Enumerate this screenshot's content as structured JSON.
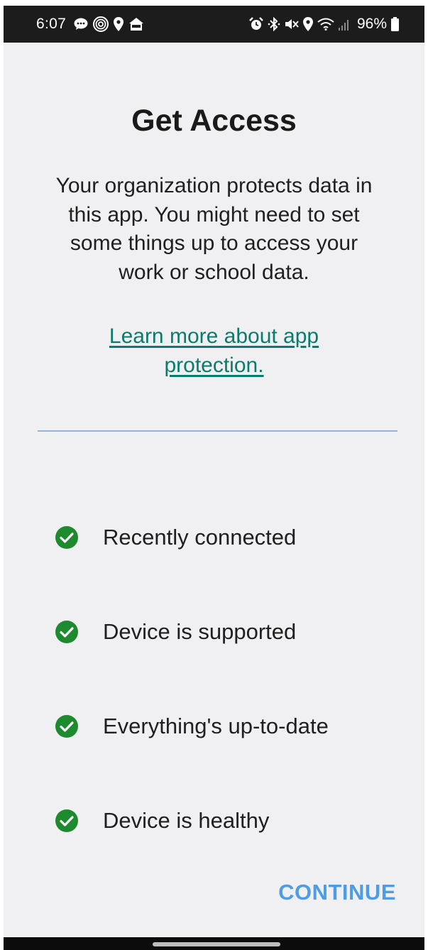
{
  "status_bar": {
    "time": "6:07",
    "battery": "96%",
    "left_icons": [
      "chat-bubble-icon",
      "fingerprint-icon",
      "location-pin-icon",
      "home-app-icon"
    ],
    "right_icons": [
      "alarm-icon",
      "bluetooth-icon",
      "mute-icon",
      "location-pin-icon",
      "wifi-icon",
      "signal-icon",
      "battery-icon"
    ]
  },
  "page": {
    "title": "Get Access",
    "description": "Your organization protects data in this app. You might need to set some things up to access your work or school data.",
    "link": "Learn more about app protection."
  },
  "checks": [
    {
      "label": "Recently connected",
      "icon": "check-circle-icon"
    },
    {
      "label": "Device is supported",
      "icon": "check-circle-icon"
    },
    {
      "label": "Everything's up-to-date",
      "icon": "check-circle-icon"
    },
    {
      "label": "Device is healthy",
      "icon": "check-circle-icon"
    }
  ],
  "actions": {
    "continue_label": "CONTINUE"
  },
  "colors": {
    "background": "#f0f0f2",
    "status_bar": "#1c1c1c",
    "check_green": "#1e8a2e",
    "link_teal": "#0b7b6b",
    "divider_blue": "#8ab8e2",
    "continue_blue": "#4e9de4"
  }
}
